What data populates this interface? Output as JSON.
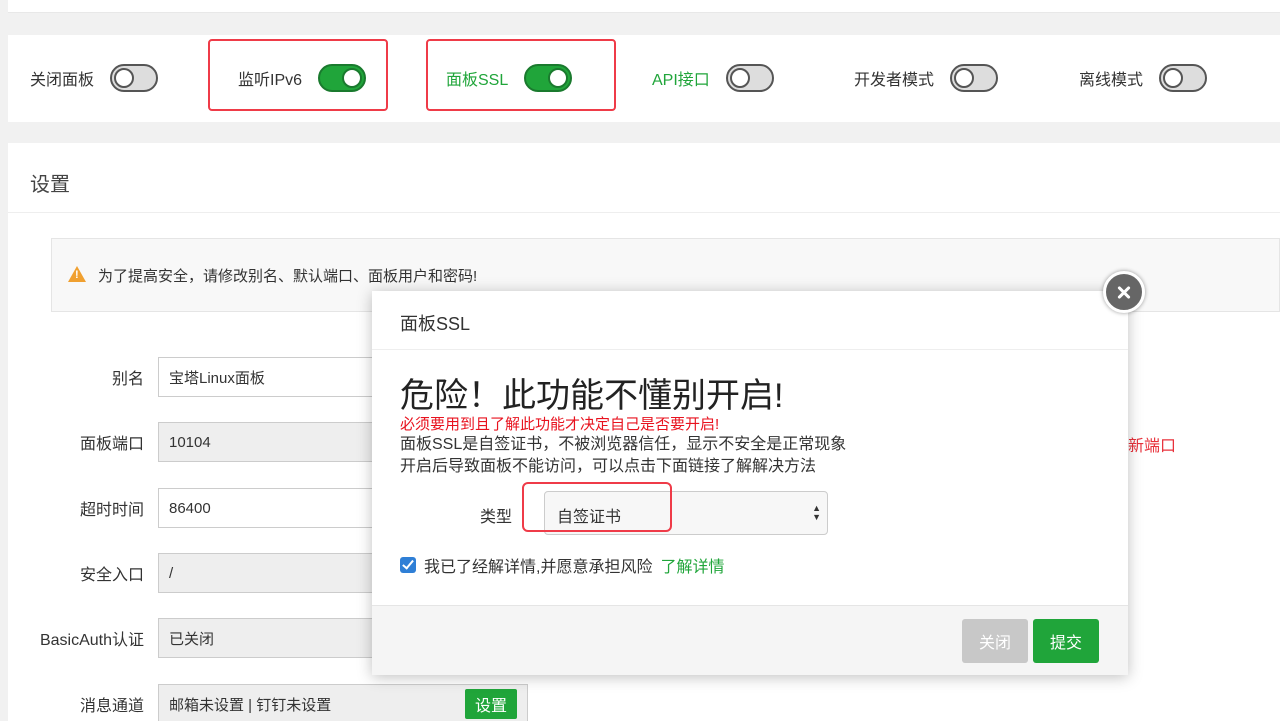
{
  "toggles": [
    {
      "label": "关闭面板",
      "on": false
    },
    {
      "label": "监听IPv6",
      "on": true
    },
    {
      "label": "面板SSL",
      "on": true
    },
    {
      "label": "API接口",
      "on": false
    },
    {
      "label": "开发者模式",
      "on": false
    },
    {
      "label": "离线模式",
      "on": false
    }
  ],
  "settings": {
    "title": "设置",
    "warning": "为了提高安全，请修改别名、默认端口、面板用户和密码!",
    "rows": [
      {
        "label": "别名",
        "value": "宝塔Linux面板"
      },
      {
        "label": "面板端口",
        "value": "10104"
      },
      {
        "label": "超时时间",
        "value": "86400"
      },
      {
        "label": "安全入口",
        "value": "/"
      },
      {
        "label": "BasicAuth认证",
        "value": "已关闭"
      },
      {
        "label": "消息通道",
        "value": "邮箱未设置 | 钉钉未设置"
      }
    ],
    "message_btn": "设置",
    "side_note": "新端口"
  },
  "dialog": {
    "title": "面板SSL",
    "danger_title": "危险！此功能不懂别开启!",
    "danger_sub": "必须要用到且了解此功能才决定自己是否要开启!",
    "info1": "面板SSL是自签证书，不被浏览器信任，显示不安全是正常现象",
    "info2": "开启后导致面板不能访问，可以点击下面链接了解解决方法",
    "type_label": "类型",
    "type_value": "自签证书",
    "agree_text": "我已了经解详情,并愿意承担风险",
    "agree_link": "了解详情",
    "cancel_btn": "关闭",
    "submit_btn": "提交"
  },
  "colors": {
    "accent": "#20a53a",
    "danger": "#e8121e",
    "highlight": "#ef3b48"
  }
}
